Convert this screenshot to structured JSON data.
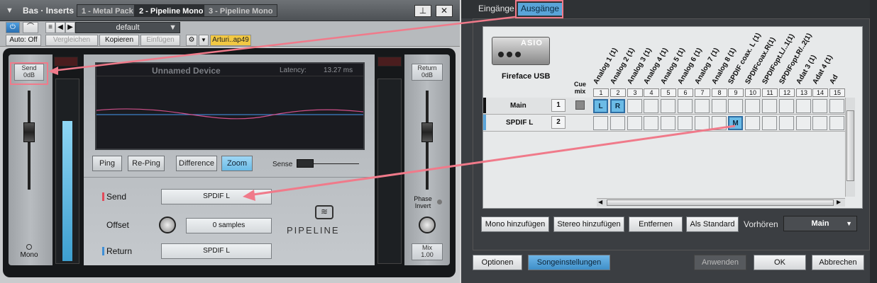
{
  "left": {
    "title": "Bas · Inserts",
    "tabs": [
      "1 - Metal Pack",
      "2 - Pipeline Mono",
      "3 - Pipeline Mono"
    ],
    "preset": "default",
    "auto": "Auto: Off",
    "compare": "Vergleichen",
    "copy": "Kopieren",
    "paste": "Einfügen",
    "plugin_name": "Arturi..ap49",
    "send_level": [
      "Send",
      "0dB"
    ],
    "return_level": [
      "Return",
      "0dB"
    ],
    "mono": "Mono",
    "mix": [
      "Mix",
      "1.00"
    ],
    "phase_invert": [
      "Phase",
      "Invert"
    ],
    "device": "Unnamed Device",
    "latency_label": "Latency:",
    "latency_value": "13.27 ms",
    "ping": "Ping",
    "reping": "Re-Ping",
    "difference": "Difference",
    "zoom": "Zoom",
    "sense": "Sense",
    "send_label": "Send",
    "send_value": "SPDIF L",
    "offset_label": "Offset",
    "offset_value": "0 samples",
    "return_label": "Return",
    "return_value": "SPDIF L",
    "logo": "PIPELINE",
    "send_meter_level": 0.78,
    "return_meter_level": 0.0
  },
  "right": {
    "tabs": [
      "Eingänge",
      "Ausgänge"
    ],
    "device_logo": "ASIO",
    "device_name": "Fireface USB",
    "cue_mix": [
      "Cue",
      "mix"
    ],
    "columns": [
      {
        "n": "1",
        "name": "Analog 1 (1)"
      },
      {
        "n": "2",
        "name": "Analog 2 (1)"
      },
      {
        "n": "3",
        "name": "Analog 3 (1)"
      },
      {
        "n": "4",
        "name": "Analog 4 (1)"
      },
      {
        "n": "5",
        "name": "Analog 5 (1)"
      },
      {
        "n": "6",
        "name": "Analog 6 (1)"
      },
      {
        "n": "7",
        "name": "Analog 7 (1)"
      },
      {
        "n": "8",
        "name": "Analog 8 (1)"
      },
      {
        "n": "9",
        "name": "SPDIF coax. L (1)"
      },
      {
        "n": "10",
        "name": "SPDIFcoax.R(1)"
      },
      {
        "n": "11",
        "name": "SPDIFopt.L/..1(1)"
      },
      {
        "n": "12",
        "name": "SPDIFopt.R/..2(1)"
      },
      {
        "n": "13",
        "name": "Adat 3 (1)"
      },
      {
        "n": "14",
        "name": "Adat 4 (1)"
      },
      {
        "n": "15",
        "name": "Ad"
      }
    ],
    "rows": [
      {
        "name": "Main",
        "channels": "1",
        "assign": {
          "1": "L",
          "2": "R"
        }
      },
      {
        "name": "SPDIF L",
        "channels": "2",
        "assign": {
          "9": "M"
        }
      }
    ],
    "add_mono": "Mono hinzufügen",
    "add_stereo": "Stereo hinzufügen",
    "remove": "Entfernen",
    "default": "Als Standard",
    "preview_label": "Vorhören",
    "preview_value": "Main",
    "options": "Optionen",
    "song_settings": "Songeinstellungen",
    "apply": "Anwenden",
    "ok": "OK",
    "cancel": "Abbrechen"
  },
  "colors": {
    "accent": "#5aa4d8",
    "annotation": "#f07a8a",
    "send_marker": "#e24a5a",
    "return_marker": "#3f8fd6"
  }
}
